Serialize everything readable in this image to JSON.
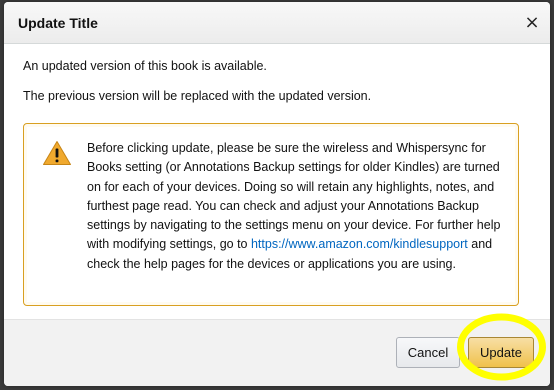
{
  "dialog": {
    "title": "Update Title",
    "close_label": "×",
    "message_line1": "An updated version of this book is available.",
    "message_line2": "The previous version will be replaced with the updated version.",
    "alert": {
      "icon": "warning-icon",
      "text_before_link": "Before clicking update, please be sure the wireless and Whispersync for Books setting (or Annotations Backup settings for older Kindles) are turned on for each of your devices. Doing so will retain any highlights, notes, and furthest page read. You can check and adjust your Annotations Backup settings by navigating to the settings menu on your device. For further help with modifying settings, go to ",
      "link_text": "https://www.amazon.com/kindlesupport",
      "text_after_link": " and check the help pages for the devices or applications you are using."
    },
    "buttons": {
      "cancel_label": "Cancel",
      "update_label": "Update"
    }
  },
  "colors": {
    "alert_border": "#d9a021",
    "link": "#0066c0",
    "update_button": "#f0c14b",
    "highlight_annotation": "#ffff00"
  }
}
